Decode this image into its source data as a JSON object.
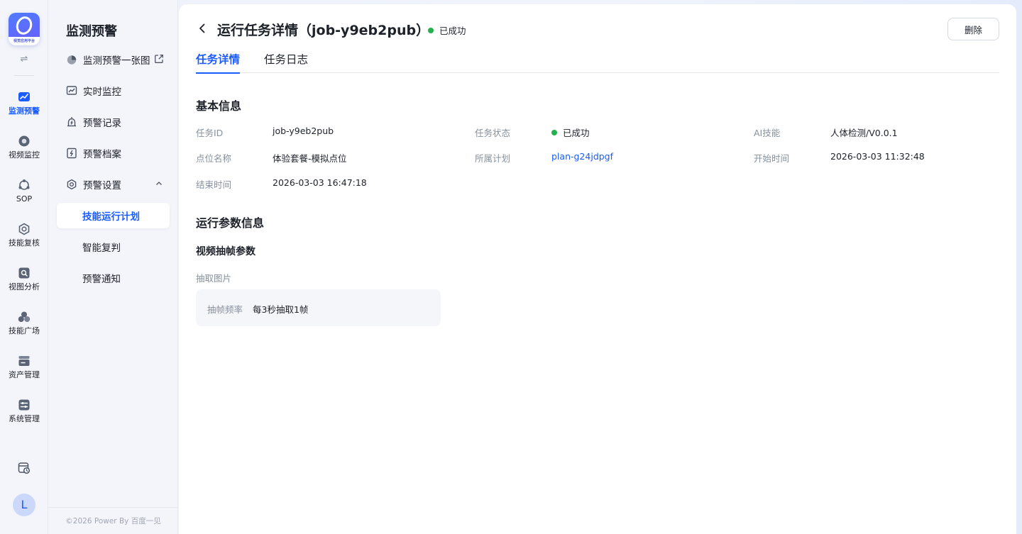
{
  "app": {
    "logo_text": "视觉应用平台",
    "accent_color": "#1a5cff",
    "success_color": "#22b14c"
  },
  "rail": {
    "toggle_glyph": "⇌",
    "items": [
      {
        "label": "监测预警",
        "icon": "monitor-chart-icon",
        "active": true
      },
      {
        "label": "视频监控",
        "icon": "camera-icon",
        "active": false
      },
      {
        "label": "SOP",
        "icon": "sop-icon",
        "active": false
      },
      {
        "label": "技能复核",
        "icon": "hexagon-check-icon",
        "active": false
      },
      {
        "label": "视图分析",
        "icon": "image-search-icon",
        "active": false
      },
      {
        "label": "技能广场",
        "icon": "cluster-icon",
        "active": false
      },
      {
        "label": "资产管理",
        "icon": "asset-box-icon",
        "active": false
      },
      {
        "label": "系统管理",
        "icon": "system-sliders-icon",
        "active": false
      }
    ],
    "avatar_letter": "L"
  },
  "subnav": {
    "title": "监测预警",
    "items": [
      {
        "label": "监测预警一张图",
        "icon": "pie-chart-icon"
      },
      {
        "label": "实时监控",
        "icon": "line-chart-icon"
      },
      {
        "label": "预警记录",
        "icon": "alarm-icon"
      },
      {
        "label": "预警档案",
        "icon": "bolt-file-icon"
      },
      {
        "label": "预警设置",
        "icon": "settings-icon"
      },
      {
        "label": "技能运行计划",
        "icon": "",
        "active": true
      },
      {
        "label": "智能复判",
        "icon": ""
      },
      {
        "label": "预警通知",
        "icon": ""
      }
    ],
    "footer": "©2026 Power By 百度一见"
  },
  "detail": {
    "title": "运行任务详情（job-y9eb2pub）",
    "status": "已成功",
    "delete_label": "删除",
    "tabs": [
      "任务详情",
      "任务日志"
    ],
    "basic_section": "基本信息",
    "fields": {
      "task_id_label": "任务ID",
      "task_id_value": "job-y9eb2pub",
      "task_status_label": "任务状态",
      "task_status_value": "已成功",
      "ai_skill_label": "AI技能",
      "ai_skill_value": "人体检测/V0.0.1",
      "point_name_label": "点位名称",
      "point_name_value": "体验套餐-模拟点位",
      "plan_label": "所属计划",
      "plan_value": "plan-g24jdpgf",
      "start_time_label": "开始时间",
      "start_time_value": "2026-03-03 11:32:48",
      "end_time_label": "结束时间",
      "end_time_value": "2026-03-03 16:47:18"
    },
    "params_section": "运行参数信息",
    "video_params_title": "视频抽帧参数",
    "extract_images_label": "抽取图片",
    "frame_rate_label": "抽帧频率",
    "frame_rate_value": "每3秒抽取1帧"
  }
}
